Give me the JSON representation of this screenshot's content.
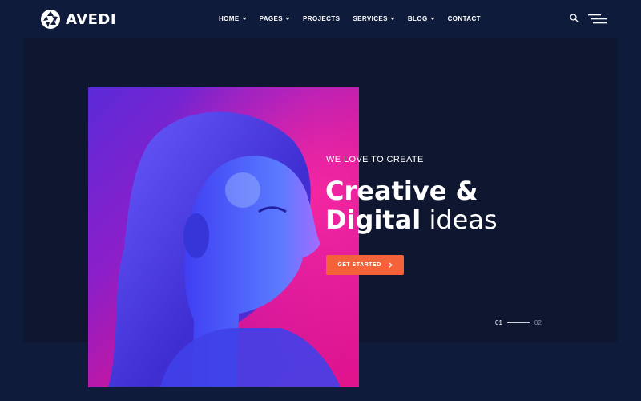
{
  "brand": {
    "name": "AVEDI"
  },
  "nav": {
    "items": [
      {
        "label": "HOME",
        "has_dropdown": true
      },
      {
        "label": "PAGES",
        "has_dropdown": true
      },
      {
        "label": "PROJECTS",
        "has_dropdown": false
      },
      {
        "label": "SERVICES",
        "has_dropdown": true
      },
      {
        "label": "BLOG",
        "has_dropdown": true
      },
      {
        "label": "CONTACT",
        "has_dropdown": false
      }
    ],
    "icons": [
      "search-icon",
      "hamburger-menu-icon"
    ]
  },
  "hero": {
    "eyebrow": "WE LOVE TO CREATE",
    "headline_line1": "Creative &",
    "headline_line2_bold": "Digital",
    "headline_line2_light": " ideas",
    "cta_label": "GET STARTED",
    "cta_icon": "arrow-right-icon",
    "image": "neon-portrait-photo"
  },
  "pager": {
    "current": "01",
    "next": "02"
  },
  "colors": {
    "background": "#0f1b3b",
    "hero_panel": "#0e1630",
    "accent": "#f4623a",
    "photo_magenta": "#e3148c",
    "photo_blue": "#3b4bff"
  }
}
